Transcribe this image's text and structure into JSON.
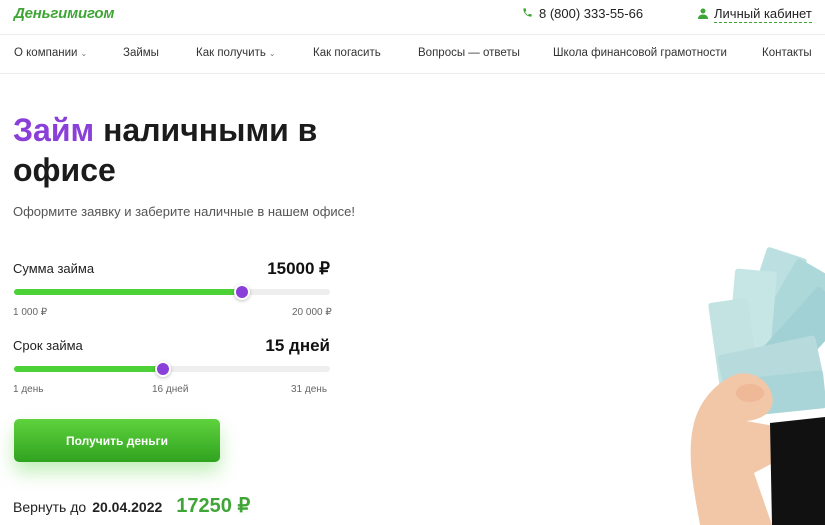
{
  "header": {
    "logo": "Деньгимигом",
    "phone": "8 (800) 333-55-66",
    "cabinet": "Личный кабинет"
  },
  "nav": [
    {
      "label": "О компании",
      "dropdown": true
    },
    {
      "label": "Займы",
      "dropdown": false
    },
    {
      "label": "Как получить",
      "dropdown": true
    },
    {
      "label": "Как погасить",
      "dropdown": false
    },
    {
      "label": "Вопросы — ответы",
      "dropdown": false
    },
    {
      "label": "Школа финансовой грамотности",
      "dropdown": false
    },
    {
      "label": "Контакты",
      "dropdown": false
    }
  ],
  "hero": {
    "title_accent": "Займ",
    "title_rest": "наличными в офисе",
    "subtitle": "Оформите заявку и заберите наличные в нашем офисе!"
  },
  "calculator": {
    "amount": {
      "label": "Сумма займа",
      "value": "15000 ₽",
      "min": "1 000 ₽",
      "max": "20 000 ₽",
      "level": 0.72
    },
    "term": {
      "label": "Срок займа",
      "value": "15 дней",
      "min": "1 день",
      "mid": "16 дней",
      "max": "31 день",
      "level": 0.47
    }
  },
  "cta": {
    "label": "Получить деньги"
  },
  "summary": {
    "prefix": "Вернуть до",
    "date": "20.04.2022",
    "amount": "17250 ₽"
  },
  "colors": {
    "green": "#3fa536",
    "purple": "#8b3fd9",
    "slider_green": "#4cd237"
  }
}
